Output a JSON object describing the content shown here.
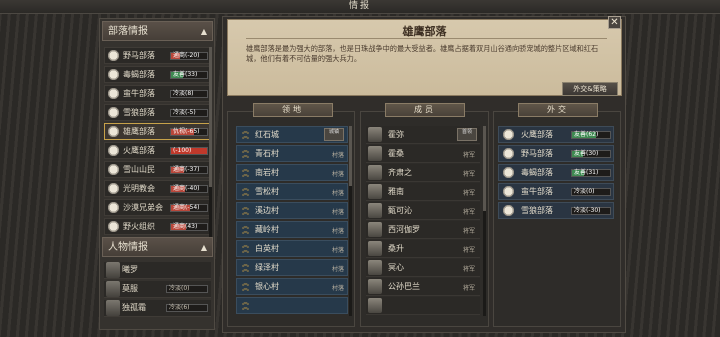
{
  "window": {
    "title": "情报"
  },
  "left": {
    "tribes_header": "部落情报",
    "tribes": [
      {
        "name": "野马部落",
        "status": "通商",
        "value": "(-20)",
        "color": "#b8473a",
        "fill": 0.25,
        "sel": false
      },
      {
        "name": "毒蝎部落",
        "status": "友善",
        "value": "(33)",
        "color": "#3f8a52",
        "fill": 0.33,
        "sel": false
      },
      {
        "name": "蛮牛部落",
        "status": "冷淡",
        "value": "(8)",
        "color": "#6a6660",
        "fill": 0.0,
        "sel": false
      },
      {
        "name": "雪狼部落",
        "status": "冷淡",
        "value": "(-5)",
        "color": "#6a6660",
        "fill": 0.0,
        "sel": false
      },
      {
        "name": "雄鹰部落",
        "status": "仇视",
        "value": "(-65)",
        "color": "#b8473a",
        "fill": 0.65,
        "sel": true
      },
      {
        "name": "火鹰部落",
        "status": "",
        "value": "(-100)",
        "color": "#c0392b",
        "fill": 1.0,
        "sel": false
      },
      {
        "name": "雪山山民",
        "status": "通商",
        "value": "(-37)",
        "color": "#b8473a",
        "fill": 0.37,
        "sel": false
      },
      {
        "name": "光明教会",
        "status": "通商",
        "value": "(-40)",
        "color": "#b8473a",
        "fill": 0.4,
        "sel": false
      },
      {
        "name": "沙漠兄弟会",
        "status": "通商",
        "value": "(-54)",
        "color": "#b8473a",
        "fill": 0.54,
        "sel": false
      },
      {
        "name": "野火组织",
        "status": "通商",
        "value": "(43)",
        "color": "#b8473a",
        "fill": 0.43,
        "sel": false
      }
    ],
    "persons_header": "人物情报",
    "persons": [
      {
        "name": "曦罗",
        "status": "",
        "value": ""
      },
      {
        "name": "莫服",
        "status": "冷淡",
        "value": "(0)"
      },
      {
        "name": "独孤霜",
        "status": "冷淡",
        "value": "(6)"
      }
    ]
  },
  "detail": {
    "title": "雄鹰部落",
    "desc": "雄鹰部落是最为强大的部落，也是日珠战争中的最大受益者。雄鹰占据着双月山谷通向骄宠城的整片区域和红石城，他们有着不可估量的强大兵力。",
    "diplomacy_button": "外交&策略",
    "close_label": "✕"
  },
  "territory": {
    "header": "领地",
    "items": [
      {
        "name": "红石城",
        "tag": "城镇"
      },
      {
        "name": "青石村",
        "tag": "村落"
      },
      {
        "name": "南岩村",
        "tag": "村落"
      },
      {
        "name": "雪松村",
        "tag": "村落"
      },
      {
        "name": "溪边村",
        "tag": "村落"
      },
      {
        "name": "藏岭村",
        "tag": "村落"
      },
      {
        "name": "白英村",
        "tag": "村落"
      },
      {
        "name": "绿泽村",
        "tag": "村落"
      },
      {
        "name": "银心村",
        "tag": "村落"
      },
      {
        "name": "",
        "tag": ""
      }
    ]
  },
  "members": {
    "header": "成员",
    "items": [
      {
        "name": "霍弥",
        "tag": "首领"
      },
      {
        "name": "霍桑",
        "tag": "将军"
      },
      {
        "name": "齐肃之",
        "tag": "将军"
      },
      {
        "name": "雅南",
        "tag": "将军"
      },
      {
        "name": "甄可沁",
        "tag": "将军"
      },
      {
        "name": "西河伽罗",
        "tag": "将军"
      },
      {
        "name": "桑升",
        "tag": "将军"
      },
      {
        "name": "冥心",
        "tag": "将军"
      },
      {
        "name": "公孙巴兰",
        "tag": "将军"
      },
      {
        "name": "",
        "tag": ""
      }
    ]
  },
  "foreign": {
    "header": "外交",
    "items": [
      {
        "name": "火鹰部落",
        "status": "友善",
        "value": "(62)",
        "color": "#3f8a52",
        "fill": 0.62
      },
      {
        "name": "野马部落",
        "status": "友善",
        "value": "(30)",
        "color": "#3f8a52",
        "fill": 0.3
      },
      {
        "name": "毒蝎部落",
        "status": "友善",
        "value": "(31)",
        "color": "#3f8a52",
        "fill": 0.31
      },
      {
        "name": "蛮牛部落",
        "status": "冷淡",
        "value": "(0)",
        "color": "#6a6660",
        "fill": 0.0
      },
      {
        "name": "雪狼部落",
        "status": "冷淡",
        "value": "(-30)",
        "color": "#6a6660",
        "fill": 0.0
      }
    ]
  }
}
